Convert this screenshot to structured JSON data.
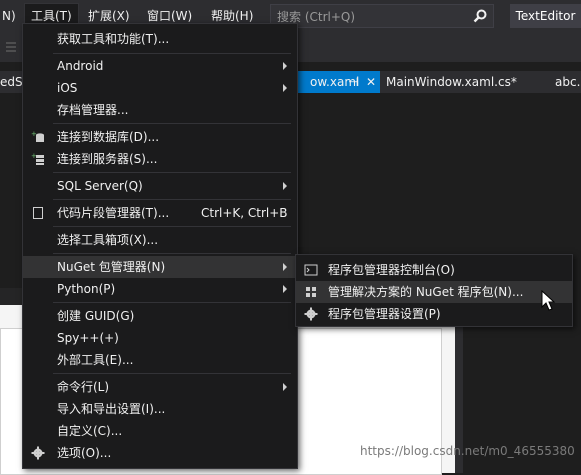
{
  "menubar": {
    "partial_n": "N)",
    "tools": "工具(T)",
    "extensions": "扩展(X)",
    "window": "窗口(W)",
    "help": "帮助(H)",
    "search_placeholder": "搜索 (Ctrl+Q)",
    "texteditor": "TextEditor"
  },
  "tabs": {
    "partial_left": "edSt",
    "main_window_xaml": "ow.xaml",
    "pin_glyph": "⊣",
    "close_glyph": "✕",
    "main_window_cs": "MainWindow.xaml.cs*",
    "abc": "abc.p"
  },
  "tools_menu": {
    "items": [
      {
        "label": "获取工具和功能(T)..."
      },
      {
        "label": "Android"
      },
      {
        "label": "iOS"
      },
      {
        "label": "存档管理器..."
      },
      {
        "label": "连接到数据库(D)..."
      },
      {
        "label": "连接到服务器(S)..."
      },
      {
        "label": "SQL Server(Q)"
      },
      {
        "label": "代码片段管理器(T)...",
        "shortcut": "Ctrl+K, Ctrl+B"
      },
      {
        "label": "选择工具箱项(X)..."
      },
      {
        "label": "NuGet 包管理器(N)"
      },
      {
        "label": "Python(P)"
      },
      {
        "label": "创建 GUID(G)"
      },
      {
        "label": "Spy++(+)"
      },
      {
        "label": "外部工具(E)..."
      },
      {
        "label": "命令行(L)"
      },
      {
        "label": "导入和导出设置(I)..."
      },
      {
        "label": "自定义(C)..."
      },
      {
        "label": "选项(O)..."
      }
    ]
  },
  "nuget_submenu": {
    "items": [
      {
        "label": "程序包管理器控制台(O)"
      },
      {
        "label": "管理解决方案的 NuGet 程序包(N)..."
      },
      {
        "label": "程序包管理器设置(P)"
      }
    ]
  },
  "watermark": "https://blog.csdn.net/m0_46555380",
  "colors": {
    "menubar_bg": "#2d2d30",
    "menu_bg": "#1b1b1c",
    "highlight": "#333334",
    "accent": "#007acc"
  }
}
